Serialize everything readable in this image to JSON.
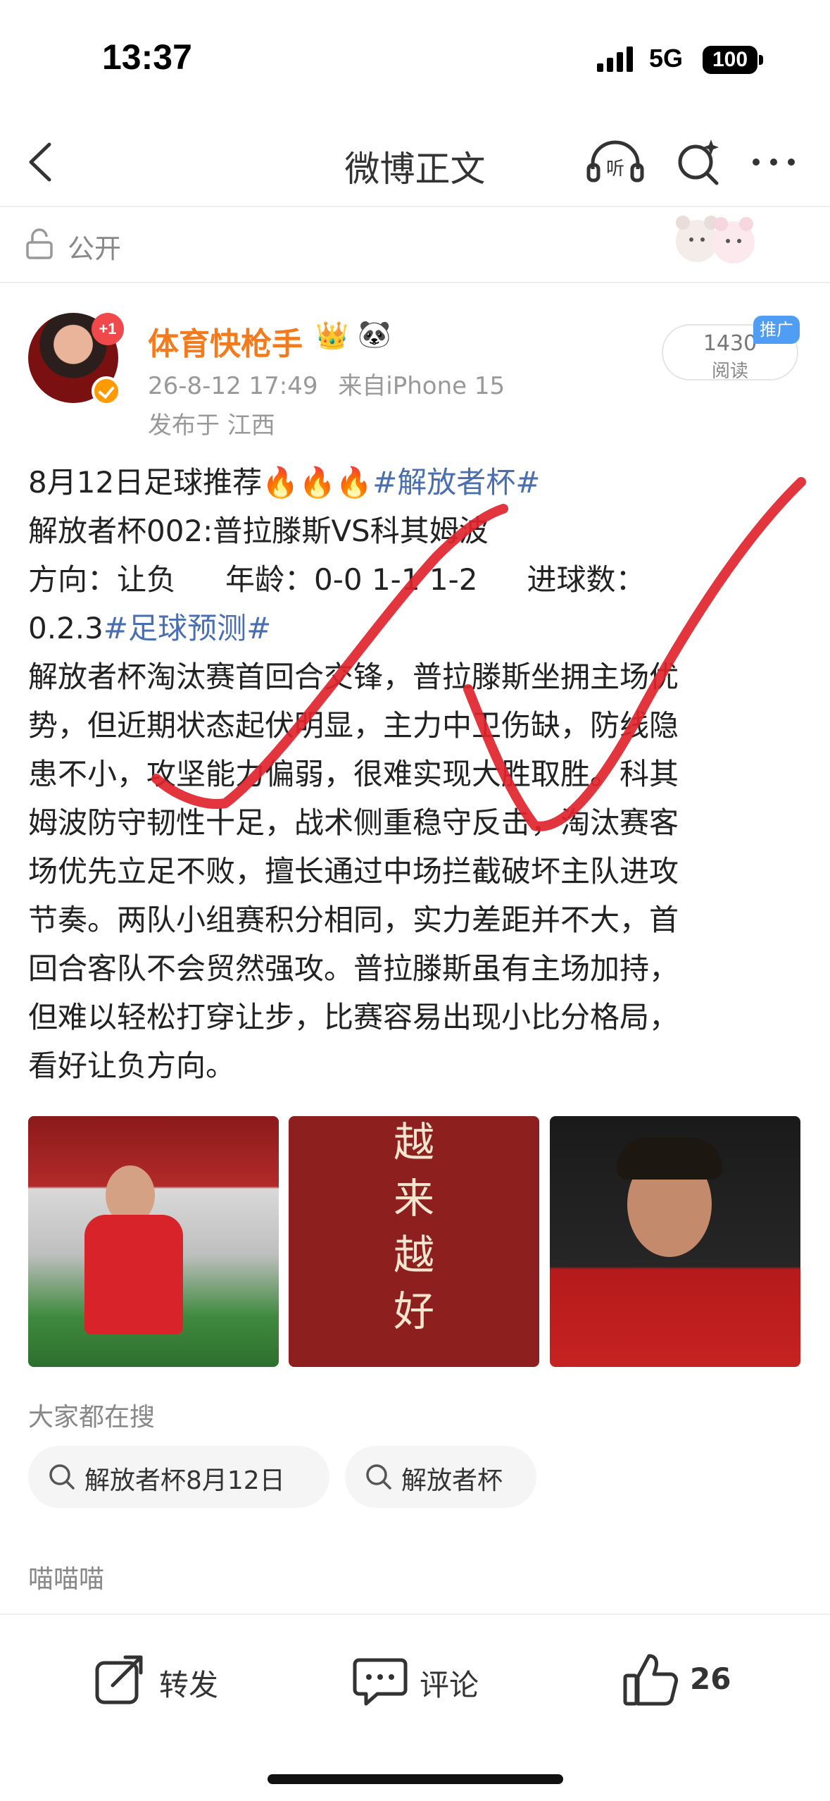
{
  "status_bar": {
    "time": "13:37",
    "network": "5G",
    "battery": "100"
  },
  "nav": {
    "title": "微博正文"
  },
  "visibility": {
    "label": "公开"
  },
  "author": {
    "name": "体育快枪手",
    "badge": "+1",
    "date": "26-8-12 17:49",
    "source": "来自iPhone 15",
    "location": "发布于 江西"
  },
  "reads": {
    "count": "1430",
    "label": "阅读",
    "promo": "推广"
  },
  "post": {
    "l1_text": "8月12日足球推荐",
    "l1_emoji": "🔥🔥🔥",
    "l1_tag": "#解放者杯#",
    "l2": "解放者杯002:普拉滕斯VS科其姆波",
    "l3_a": "方向：让负",
    "l3_b": "年龄：0-0 1-1 1-2",
    "l3_c": "进球数：",
    "l4_text": "0.2.3",
    "l4_tag": "#足球预测#",
    "lines": [
      "解放者杯淘汰赛首回合交锋，普拉滕斯坐拥主场优",
      "势，但近期状态起伏明显，主力中卫伤缺，防线隐",
      "患不小，攻坚能力偏弱，很难实现大胜取胜。科其",
      "姆波防守韧性十足，战术侧重稳守反击，淘汰赛客",
      "场优先立足不败，擅长通过中场拦截破坏主队进攻",
      "节奏。两队小组赛积分相同，实力差距并不大，首",
      "回合客队不会贸然强攻。普拉滕斯虽有主场加持，",
      "但难以轻松打穿让步，比赛容易出现小比分格局，",
      "看好让负方向。"
    ]
  },
  "images": {
    "calligraphy": [
      "越",
      "来",
      "越",
      "好"
    ]
  },
  "search": {
    "title": "大家都在搜",
    "chips": [
      "解放者杯8月12日",
      "解放者杯"
    ]
  },
  "comments": {
    "preview_author": "喵喵喵"
  },
  "actions": {
    "repost": "转发",
    "comment": "评论",
    "likes": "26"
  },
  "colors": {
    "username": "#f37b1d",
    "hashtag": "#4a6fb0",
    "check_stroke": "#e0242c"
  }
}
